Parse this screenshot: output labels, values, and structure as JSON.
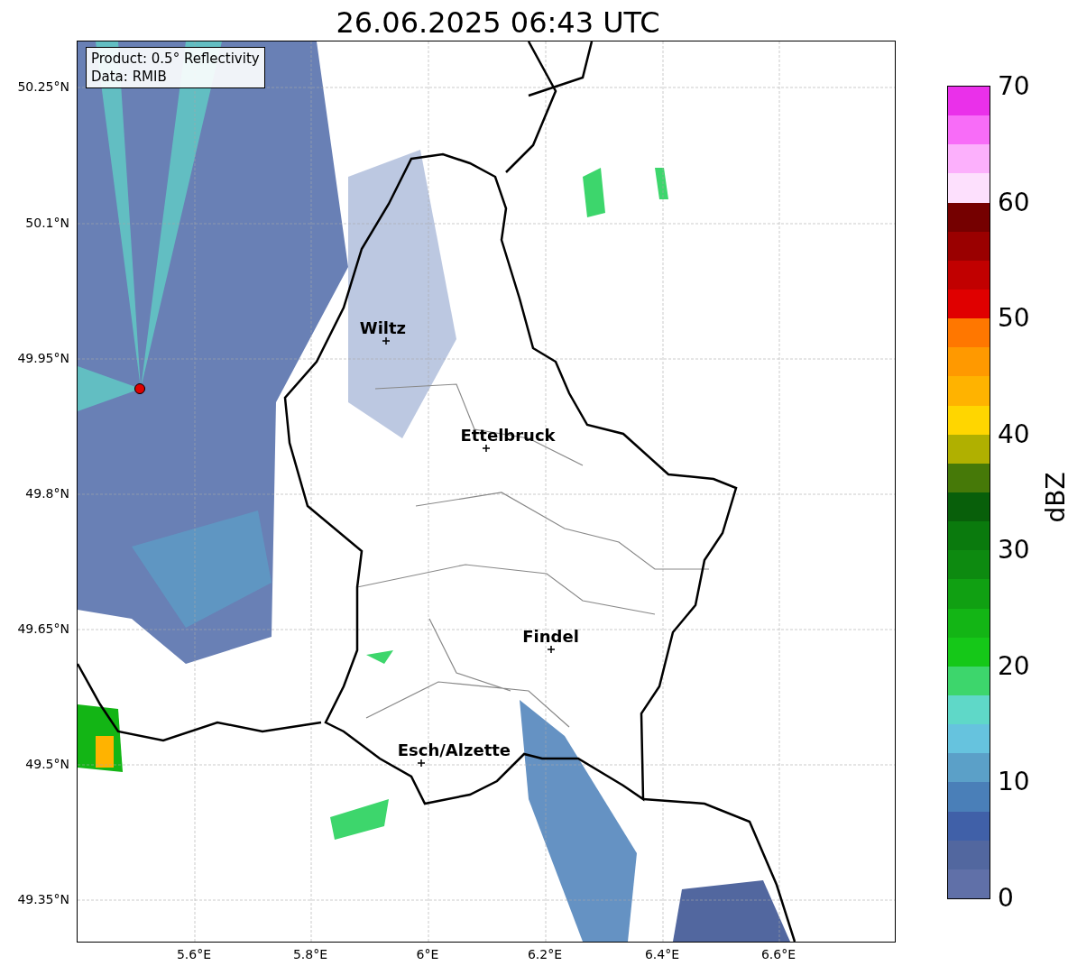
{
  "title": "26.06.2025 06:43 UTC",
  "info_box": [
    "Product: 0.5° Reflectivity",
    "Data: RMIB"
  ],
  "y_ticks": [
    "50.25°N",
    "50.1°N",
    "49.95°N",
    "49.8°N",
    "49.65°N",
    "49.5°N",
    "49.35°N"
  ],
  "x_ticks": [
    "5.6°E",
    "5.8°E",
    "6°E",
    "6.2°E",
    "6.4°E",
    "6.6°E"
  ],
  "cities": [
    {
      "name": "Wiltz"
    },
    {
      "name": "Ettelbruck"
    },
    {
      "name": "Findel"
    },
    {
      "name": "Esch/Alzette"
    }
  ],
  "colorbar": {
    "label": "dBZ",
    "ticks": [
      "70",
      "60",
      "50",
      "40",
      "30",
      "20",
      "10",
      "0"
    ],
    "bands": [
      {
        "color": "#ea30ea"
      },
      {
        "color": "#f86cf8"
      },
      {
        "color": "#fcb0fc"
      },
      {
        "color": "#fde0fd"
      },
      {
        "color": "#750000"
      },
      {
        "color": "#9a0000"
      },
      {
        "color": "#c10000"
      },
      {
        "color": "#e00000"
      },
      {
        "color": "#ff7700"
      },
      {
        "color": "#ff9900"
      },
      {
        "color": "#ffb300"
      },
      {
        "color": "#ffd600"
      },
      {
        "color": "#b0b000"
      },
      {
        "color": "#467908"
      },
      {
        "color": "#085f0a"
      },
      {
        "color": "#0a7a0d"
      },
      {
        "color": "#0d8a10"
      },
      {
        "color": "#10a012"
      },
      {
        "color": "#13b515"
      },
      {
        "color": "#15c818"
      },
      {
        "color": "#3dd66c"
      },
      {
        "color": "#5fd8c8"
      },
      {
        "color": "#66c3de"
      },
      {
        "color": "#5ba0c8"
      },
      {
        "color": "#4a7fb8"
      },
      {
        "color": "#4060a8"
      },
      {
        "color": "#52679f"
      },
      {
        "color": "#6070a8"
      }
    ]
  }
}
